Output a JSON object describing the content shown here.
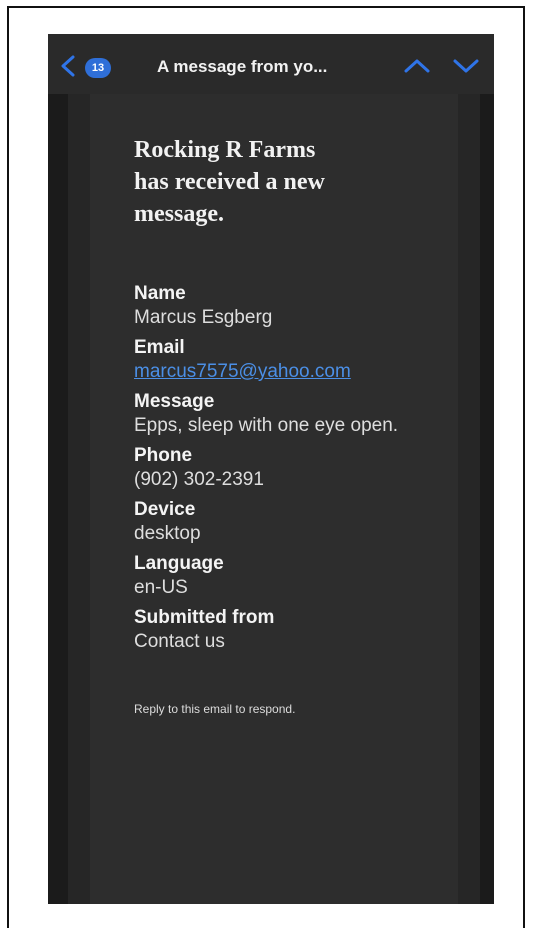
{
  "nav": {
    "badge_count": "13",
    "title": "A message from yo..."
  },
  "email": {
    "headline_line1": "Rocking R Farms",
    "headline_line2": "has received a new",
    "headline_line3": "message.",
    "fields": [
      {
        "label": "Name",
        "value": "Marcus Esgberg"
      },
      {
        "label": "Email",
        "value": "marcus7575@yahoo.com"
      },
      {
        "label": "Message",
        "value": "Epps, sleep with one eye open."
      },
      {
        "label": "Phone",
        "value": "(902) 302-2391"
      },
      {
        "label": "Device",
        "value": "desktop"
      },
      {
        "label": "Language",
        "value": "en-US"
      },
      {
        "label": "Submitted from",
        "value": "Contact us"
      }
    ],
    "footer": "Reply to this email to respond."
  },
  "colors": {
    "accent": "#2f6fd8",
    "link": "#4b8fe6",
    "background": "#1c1c1c"
  },
  "icons": {
    "back": "chevron-left-icon",
    "previous": "chevron-up-icon",
    "next": "chevron-down-icon"
  }
}
